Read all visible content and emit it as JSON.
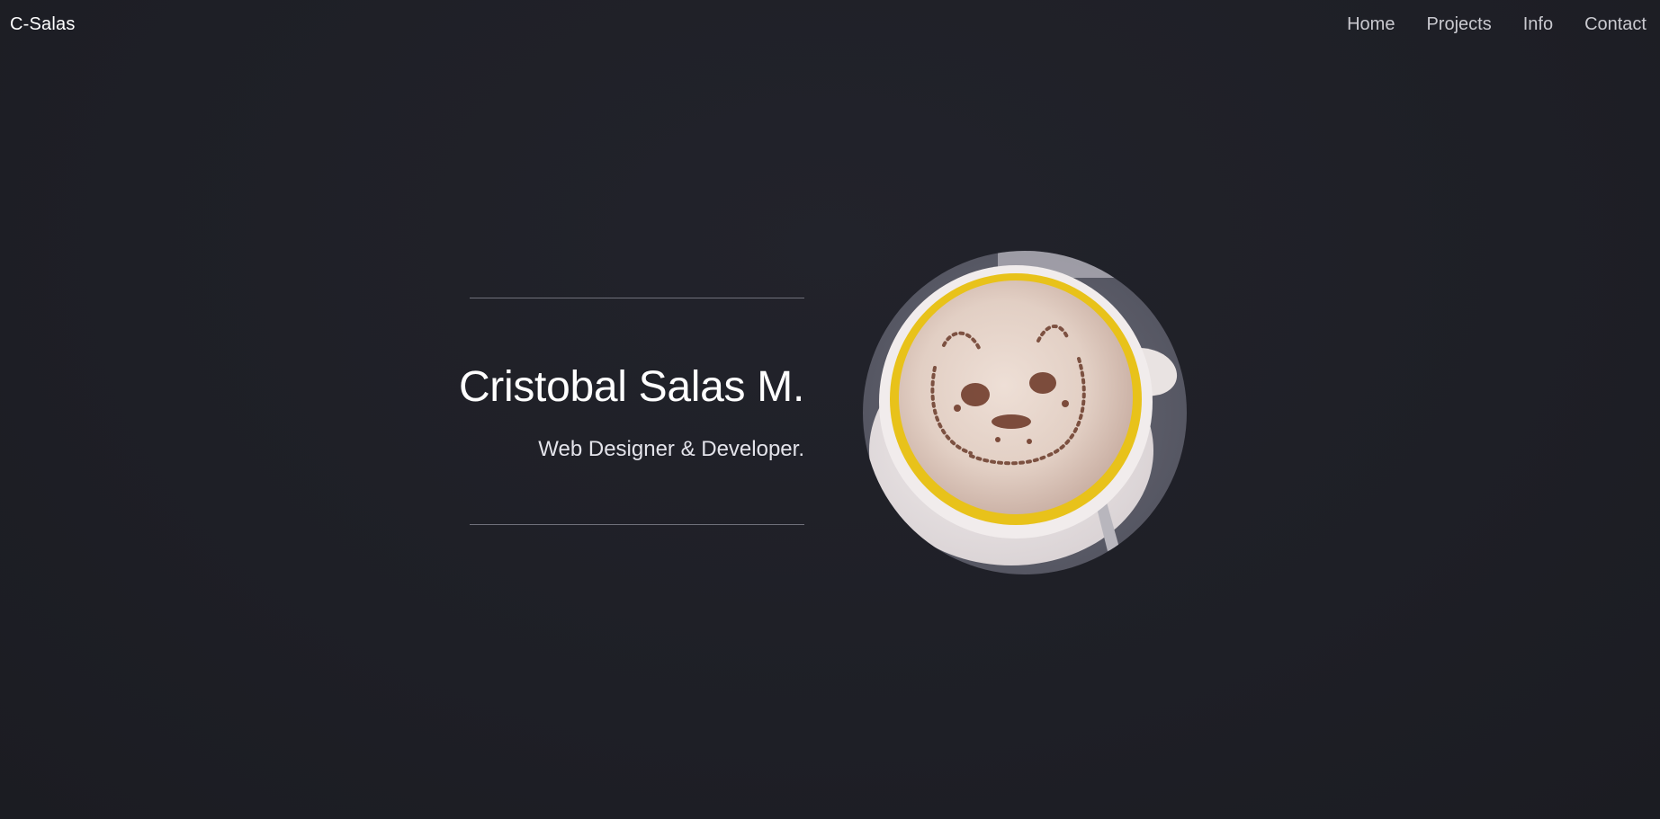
{
  "header": {
    "brand": "C-Salas",
    "nav": [
      {
        "label": "Home"
      },
      {
        "label": "Projects"
      },
      {
        "label": "Info"
      },
      {
        "label": "Contact"
      }
    ]
  },
  "hero": {
    "name": "Cristobal Salas M.",
    "tagline": "Web Designer & Developer.",
    "photo_icon": "coffee-cup-latte-art-photo"
  },
  "colors": {
    "background": "#1e1f26",
    "text": "#ffffff",
    "nav_text": "#c9c9cf",
    "rule": "#6f707a",
    "cup_rim": "#e8c21a"
  }
}
